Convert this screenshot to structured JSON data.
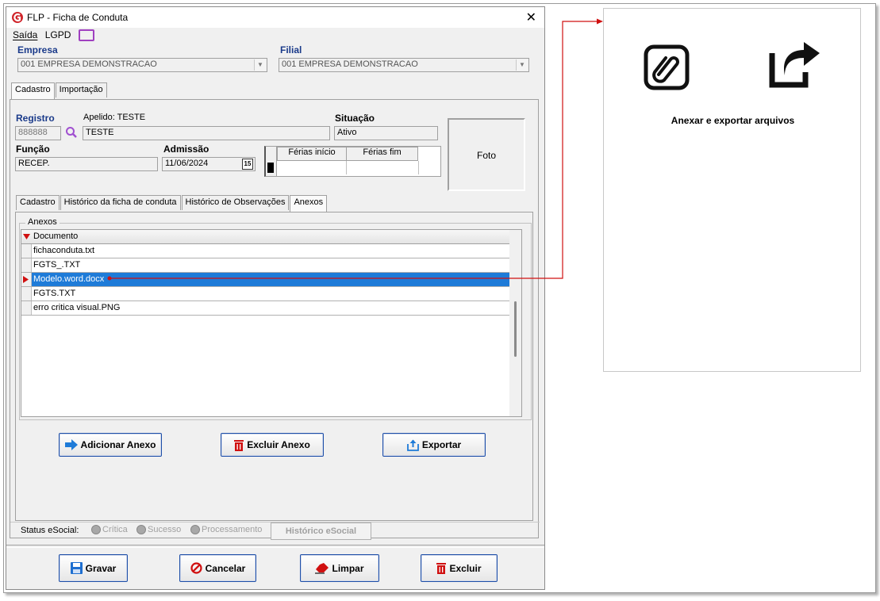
{
  "window": {
    "title": "FLP - Ficha de Conduta",
    "close": "✕"
  },
  "menu": {
    "saida": "Saída",
    "lgpd": "LGPD"
  },
  "empresa": {
    "label": "Empresa",
    "value": "001 EMPRESA DEMONSTRACAO"
  },
  "filial": {
    "label": "Filial",
    "value": "001 EMPRESA DEMONSTRACAO"
  },
  "top_tabs": [
    "Cadastro",
    "Importação"
  ],
  "registro": {
    "label": "Registro",
    "value": "888888"
  },
  "apelido": {
    "label": "Apelido: TESTE",
    "value": "TESTE"
  },
  "situacao": {
    "label": "Situação",
    "value": "Ativo"
  },
  "funcao": {
    "label": "Função",
    "value": "RECEP."
  },
  "admissao": {
    "label": "Admissão",
    "value": "11/06/2024",
    "calendar": "15"
  },
  "ferias": {
    "inicio": "Férias início",
    "fim": "Férias fim"
  },
  "foto": "Foto",
  "inner_tabs": [
    "Cadastro",
    "Histórico da ficha de conduta",
    "Histórico de Observações",
    "Anexos"
  ],
  "anexos": {
    "group": "Anexos",
    "column": "Documento",
    "rows": [
      "fichaconduta.txt",
      "FGTS_.TXT",
      "Modelo.word.docx",
      "FGTS.TXT",
      "erro critica visual.PNG"
    ],
    "selected_index": 2
  },
  "buttons": {
    "adicionar": "Adicionar Anexo",
    "excluir_anexo": "Excluir Anexo",
    "exportar": "Exportar"
  },
  "status": {
    "label": "Status eSocial:",
    "critica": "Crítica",
    "sucesso": "Sucesso",
    "processamento": "Processamento",
    "historico": "Histórico eSocial"
  },
  "bottom": {
    "gravar": "Gravar",
    "cancelar": "Cancelar",
    "limpar": "Limpar",
    "excluir": "Excluir"
  },
  "callout": {
    "caption": "Anexar e exportar arquivos"
  },
  "colors": {
    "accent": "#1e7bd8",
    "label_blue": "#1a3a8a",
    "arrow_red": "#d01010"
  }
}
